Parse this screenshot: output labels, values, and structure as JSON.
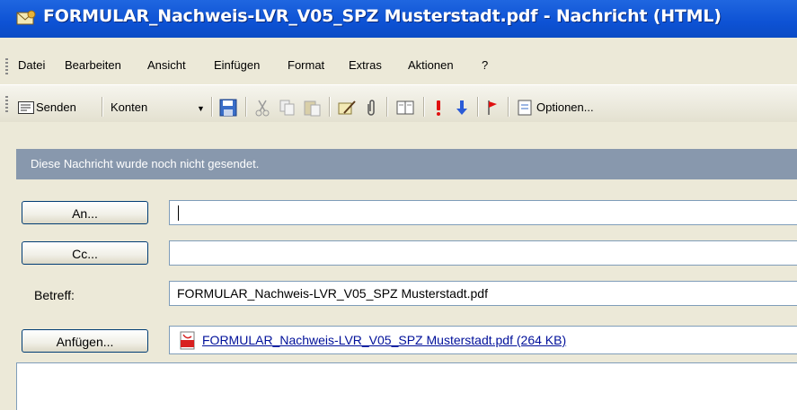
{
  "window": {
    "title": "FORMULAR_Nachweis-LVR_V05_SPZ Musterstadt.pdf - Nachricht (HTML)",
    "app_icon": "envelope-icon"
  },
  "menu": {
    "items": [
      {
        "label": "Datei"
      },
      {
        "label": "Bearbeiten"
      },
      {
        "label": "Ansicht"
      },
      {
        "label": "Einfügen"
      },
      {
        "label": "Format"
      },
      {
        "label": "Extras"
      },
      {
        "label": "Aktionen"
      },
      {
        "label": "?"
      }
    ]
  },
  "toolbar": {
    "send_label": "Senden",
    "accounts_label": "Konten",
    "options_label": "Optionen...",
    "icons": [
      "save-icon",
      "cut-icon",
      "copy-icon",
      "paste-icon",
      "signature-icon",
      "paperclip-icon",
      "address-book-icon",
      "high-importance-icon",
      "low-importance-icon",
      "flag-icon",
      "options-icon"
    ]
  },
  "infobar": {
    "text": "Diese Nachricht wurde noch nicht gesendet."
  },
  "form": {
    "to_button": "An...",
    "to_value": "",
    "cc_button": "Cc...",
    "cc_value": "",
    "subject_label": "Betreff:",
    "subject_value": "FORMULAR_Nachweis-LVR_V05_SPZ Musterstadt.pdf",
    "attach_button": "Anfügen...",
    "attachment": "FORMULAR_Nachweis-LVR_V05_SPZ Musterstadt.pdf (264 KB)"
  },
  "colors": {
    "titlebar": "#0d52d4",
    "infobar": "#8898ad",
    "chrome": "#ece9d8",
    "link": "#00109a"
  }
}
